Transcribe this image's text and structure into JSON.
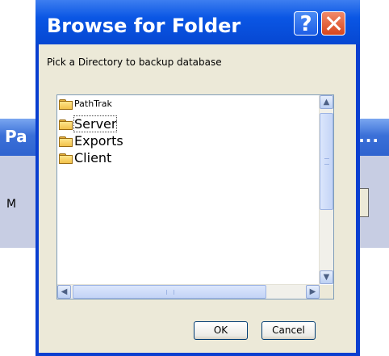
{
  "background_window": {
    "title_left": "Pa",
    "title_right": "...",
    "label_fragment": "M"
  },
  "dialog": {
    "title": "Browse for Folder",
    "help_glyph": "?",
    "prompt": "Pick a Directory to backup database",
    "tree": {
      "root": "PathTrak",
      "items": [
        "Server",
        "Exports",
        "Client"
      ]
    },
    "buttons": {
      "ok": "OK",
      "cancel": "Cancel"
    }
  },
  "colors": {
    "titlebar": "#0a56e4",
    "client": "#ece9d8",
    "folder": "#f1c14a"
  }
}
